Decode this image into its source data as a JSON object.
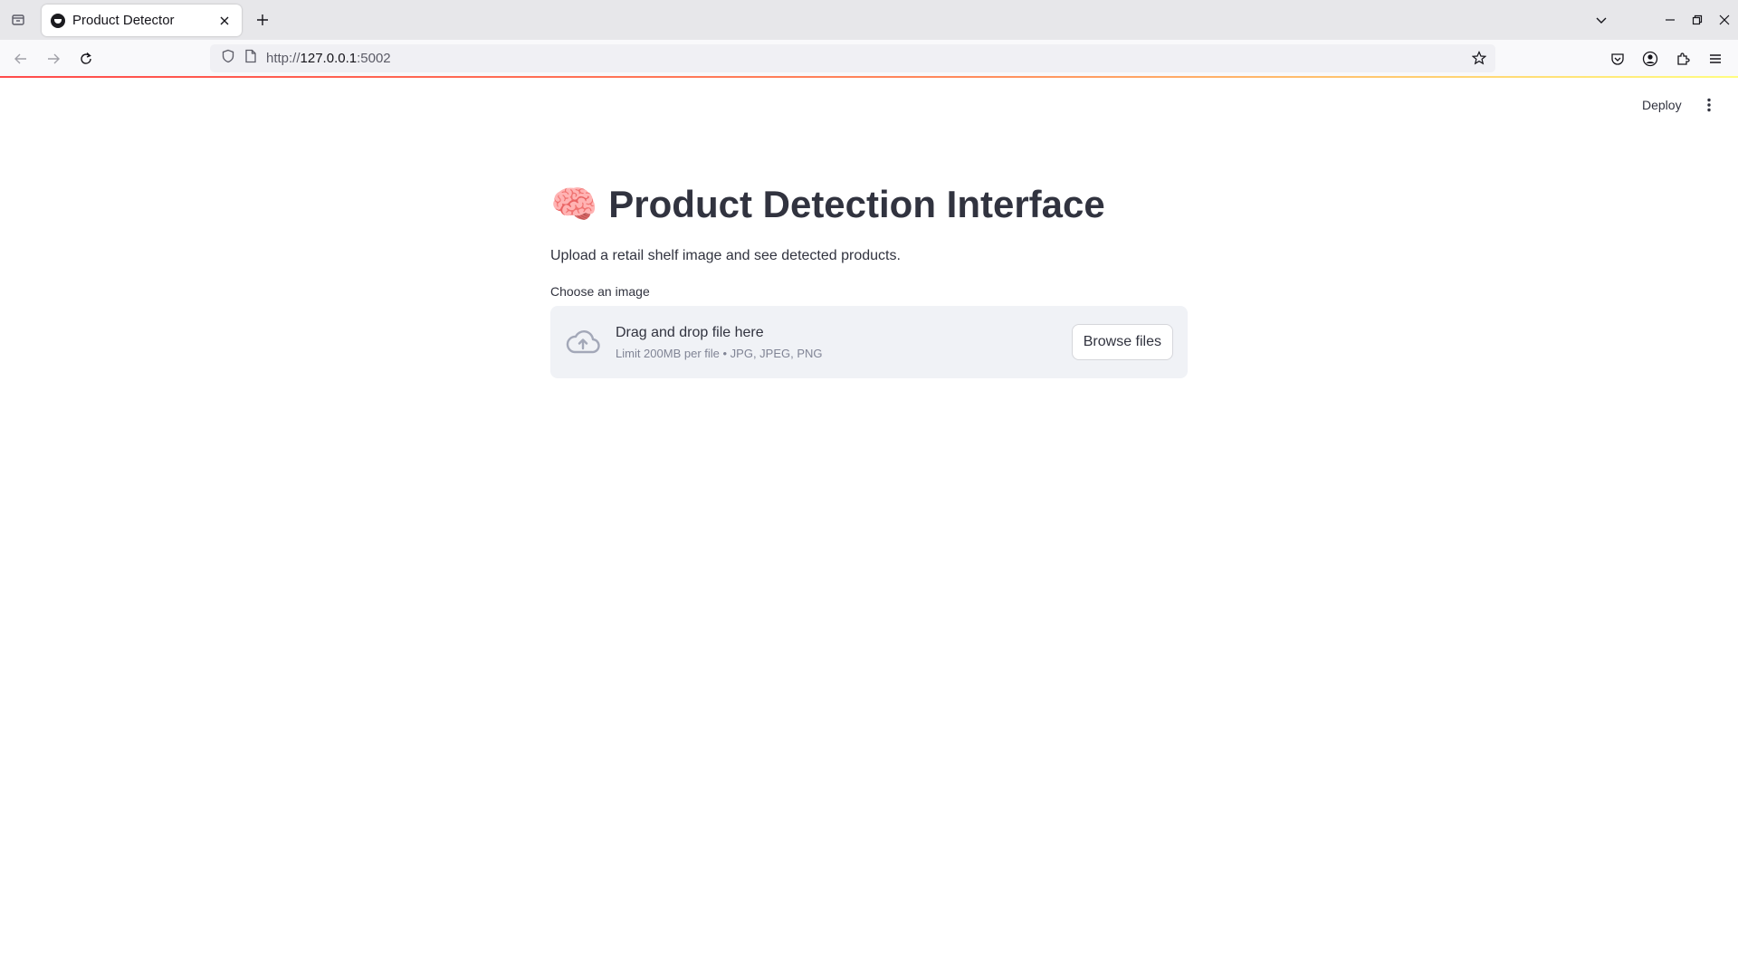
{
  "browser": {
    "tab_title": "Product Detector",
    "url_scheme": "http://",
    "url_host": "127.0.0.1",
    "url_port": ":5002"
  },
  "header": {
    "deploy_label": "Deploy"
  },
  "main": {
    "title_emoji": "🧠",
    "title": "Product Detection Interface",
    "subtitle": "Upload a retail shelf image and see detected products.",
    "uploader": {
      "label": "Choose an image",
      "drop_text": "Drag and drop file here",
      "limit_text": "Limit 200MB per file • JPG, JPEG, PNG",
      "browse_label": "Browse files"
    }
  },
  "colors": {
    "accent": "#ff4b4b",
    "text": "#31333f",
    "dropzone_bg": "#f0f2f6"
  }
}
